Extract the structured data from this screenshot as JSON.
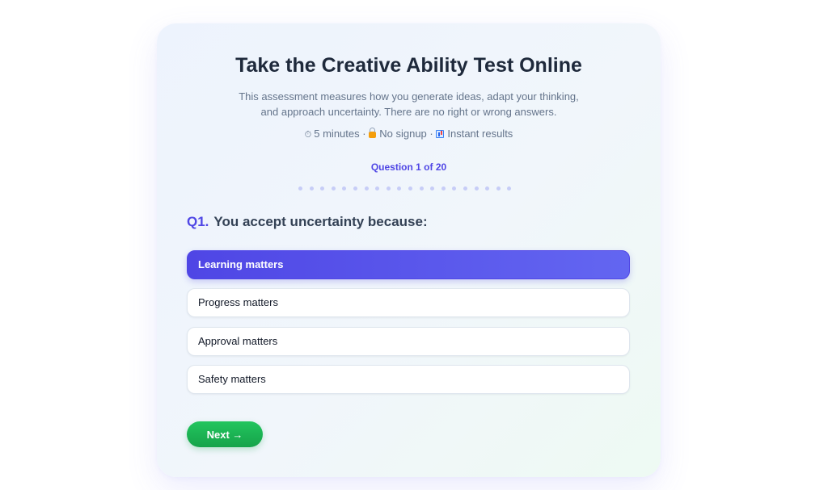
{
  "header": {
    "title": "Take the Creative Ability Test Online",
    "subtitle": "This assessment measures how you generate ideas, adapt your thinking, and approach uncertainty. There are no right or wrong answers.",
    "meta": {
      "duration_icon": "stopwatch-icon",
      "duration": "5 minutes",
      "separator": "·",
      "signup_icon": "lock-icon",
      "signup": "No signup",
      "results_icon": "bar-chart-icon",
      "results": "Instant results"
    }
  },
  "progress": {
    "label": "Question 1 of 20",
    "current": 1,
    "total": 20,
    "dot_color": "#c7cdf7"
  },
  "question": {
    "number": "Q1.",
    "text": "You accept uncertainty because:"
  },
  "options": [
    {
      "label": "Learning matters",
      "selected": true
    },
    {
      "label": "Progress matters",
      "selected": false
    },
    {
      "label": "Approval matters",
      "selected": false
    },
    {
      "label": "Safety matters",
      "selected": false
    }
  ],
  "next_button": {
    "label": "Next →"
  },
  "colors": {
    "accent": "#4f46e5",
    "selected_option": "#5b55ea",
    "next_button": "#22c55e",
    "title": "#1e293b",
    "muted_text": "#64748b"
  }
}
